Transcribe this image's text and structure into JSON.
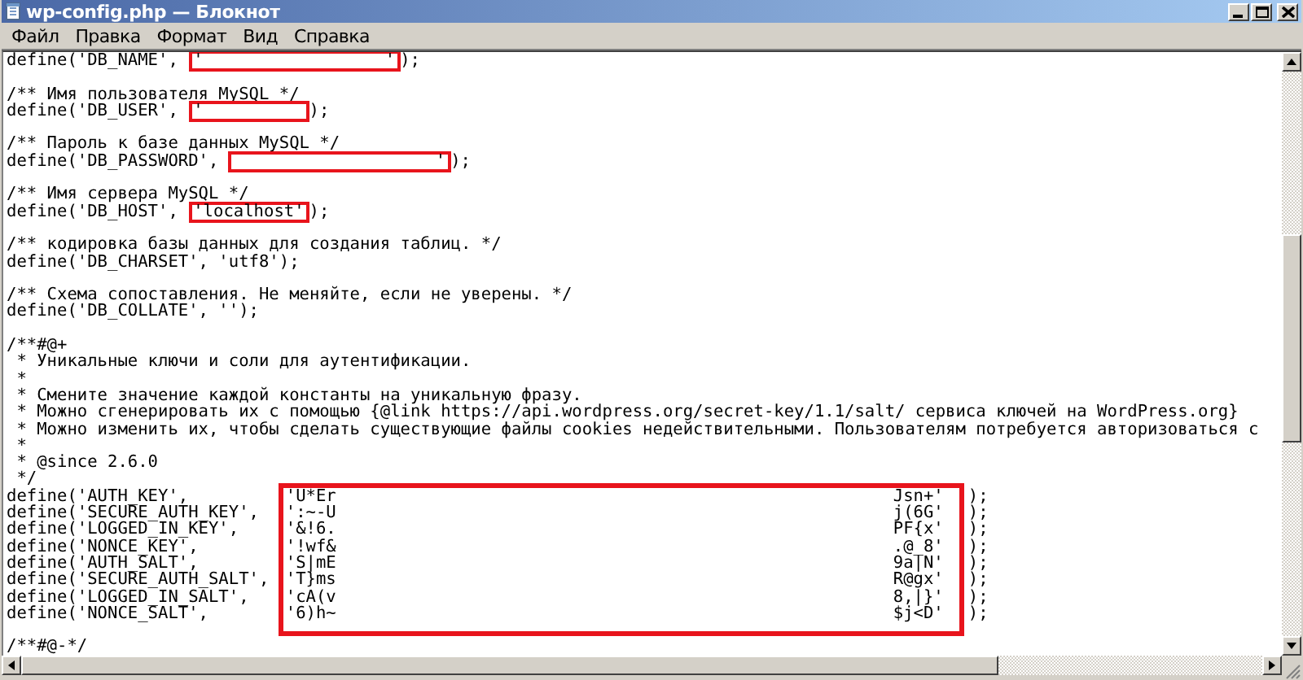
{
  "window": {
    "title": "wp-config.php — Блокнот"
  },
  "menu": [
    {
      "label": "Файл"
    },
    {
      "label": "Правка"
    },
    {
      "label": "Формат"
    },
    {
      "label": "Вид"
    },
    {
      "label": "Справка"
    }
  ],
  "lines_before": [
    {
      "kind": "redacted",
      "before": "define('DB_NAME', ",
      "value": "'                  '",
      "after": ");"
    },
    {
      "kind": "blank"
    },
    {
      "kind": "code",
      "text": "/** Имя пользователя MySQL */"
    },
    {
      "kind": "redacted",
      "before": "define('DB_USER', ",
      "value": "'          ",
      "after": ");"
    },
    {
      "kind": "blank"
    },
    {
      "kind": "code",
      "text": "/** Пароль к базе данных MySQL */"
    },
    {
      "kind": "redacted",
      "before": "define('DB_PASSWORD', ",
      "value": "                    '",
      "after": ");"
    },
    {
      "kind": "blank"
    },
    {
      "kind": "code",
      "text": "/** Имя сервера MySQL */"
    },
    {
      "kind": "redacted",
      "before": "define('DB_HOST', ",
      "value": "'localhost'",
      "after": ");"
    },
    {
      "kind": "blank"
    },
    {
      "kind": "code",
      "text": "/** кодировка базы данных для создания таблиц. */"
    },
    {
      "kind": "code",
      "text": "define('DB_CHARSET', 'utf8');"
    },
    {
      "kind": "blank"
    },
    {
      "kind": "code",
      "text": "/** Схема сопоставления. Не меняйте, если не уверены. */"
    },
    {
      "kind": "code",
      "text": "define('DB_COLLATE', '');"
    },
    {
      "kind": "blank"
    },
    {
      "kind": "code",
      "text": "/**#@+"
    },
    {
      "kind": "code",
      "text": " * Уникальные ключи и соли для аутентификации."
    },
    {
      "kind": "code",
      "text": " *"
    },
    {
      "kind": "code",
      "text": " * Смените значение каждой константы на уникальную фразу."
    },
    {
      "kind": "code",
      "text": " * Можно сгенерировать их с помощью {@link https://api.wordpress.org/secret-key/1.1/salt/ сервиса ключей на WordPress.org}"
    },
    {
      "kind": "code",
      "text": " * Можно изменить их, чтобы сделать существующие файлы cookies недействительными. Пользователям потребуется авторизоваться с"
    },
    {
      "kind": "code",
      "text": " *"
    },
    {
      "kind": "code",
      "text": " * @since 2.6.0"
    },
    {
      "kind": "code",
      "text": " */"
    }
  ],
  "secret_keys": [
    {
      "name": "define('AUTH_KEY',",
      "start": "'U*Er",
      "end": "Jsn+'",
      "after": ");"
    },
    {
      "name": "define('SECURE_AUTH_KEY',",
      "start": "':~-U",
      "end": "j(6G'",
      "after": ");"
    },
    {
      "name": "define('LOGGED_IN_KEY',",
      "start": "'&!6.",
      "end": "PF{x'",
      "after": ");"
    },
    {
      "name": "define('NONCE_KEY',",
      "start": "'!wf&",
      "end": ".@_8'",
      "after": ");"
    },
    {
      "name": "define('AUTH_SALT',",
      "start": "'S|mE",
      "end": "9a|N'",
      "after": ");"
    },
    {
      "name": "define('SECURE_AUTH_SALT',",
      "start": "'T}ms",
      "end": "R@gx'",
      "after": ");"
    },
    {
      "name": "define('LOGGED_IN_SALT',",
      "start": "'cA(v",
      "end": "8,|}'",
      "after": ");"
    },
    {
      "name": "define('NONCE_SALT',",
      "start": "'6)h~",
      "end": "$j<D'",
      "after": ");"
    }
  ],
  "lines_after": [
    {
      "kind": "blank"
    },
    {
      "kind": "code",
      "text": "/**#@-*/"
    }
  ]
}
